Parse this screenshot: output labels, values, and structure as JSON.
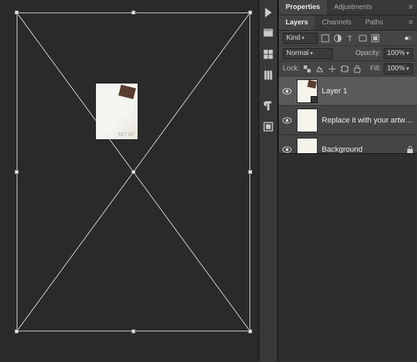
{
  "panel": {
    "tabs_top": {
      "properties": "Properties",
      "adjustments": "Adjustments"
    },
    "tabs_layers": {
      "layers": "Layers",
      "channels": "Channels",
      "paths": "Paths"
    },
    "filter": {
      "kind_label": "Kind"
    },
    "blend": {
      "mode": "Normal",
      "opacity_label": "Opacity:",
      "opacity_value": "100%"
    },
    "lock": {
      "label": "Lock:",
      "fill_label": "Fill:",
      "fill_value": "100%"
    }
  },
  "layers": [
    {
      "name": "Layer 1",
      "visible": true,
      "selected": true,
      "smart": true
    },
    {
      "name": "Replace it with your artwork",
      "visible": true,
      "selected": false,
      "smart": false
    },
    {
      "name": "Background",
      "visible": true,
      "selected": false,
      "smart": false,
      "locked": true
    }
  ],
  "placed": {
    "caption": "SET OF"
  }
}
